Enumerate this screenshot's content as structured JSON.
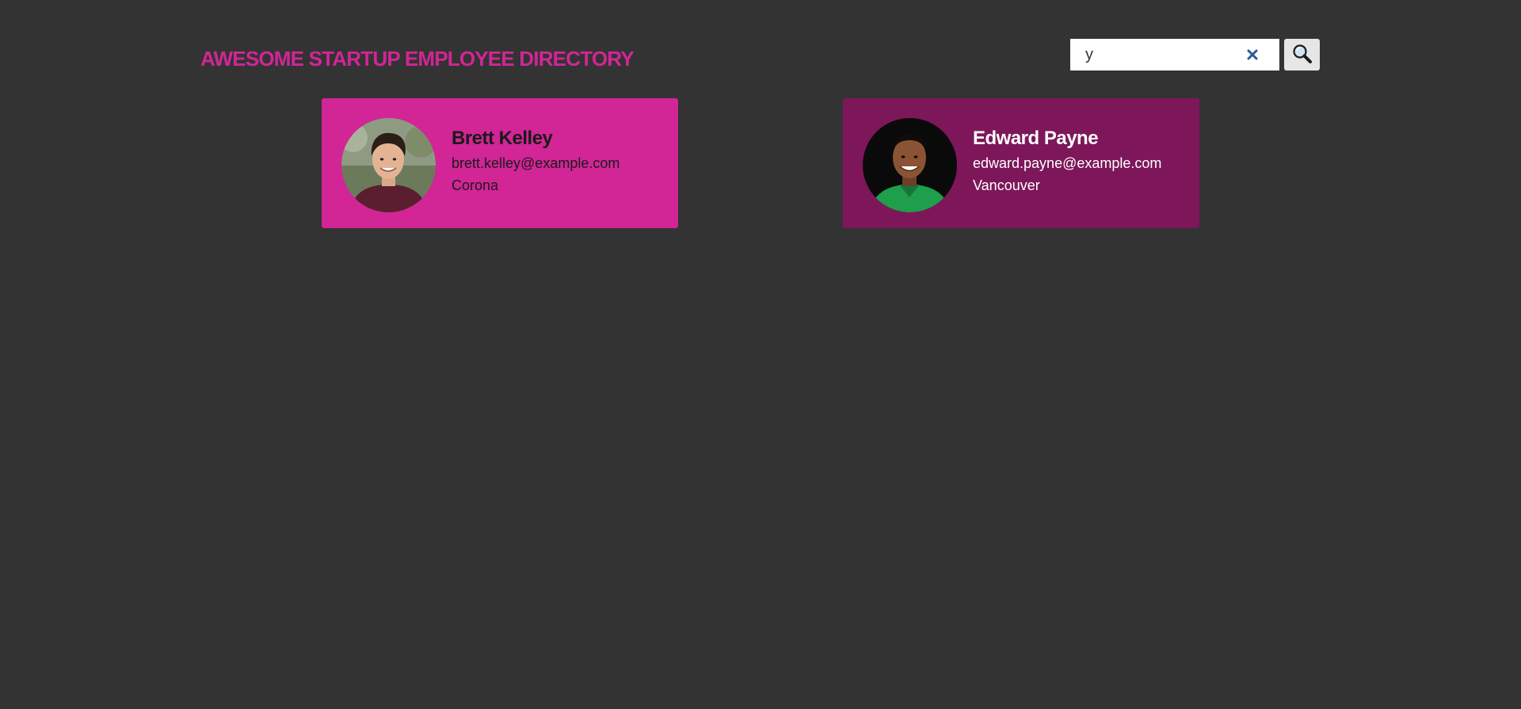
{
  "header": {
    "title": "AWESOME STARTUP EMPLOYEE DIRECTORY"
  },
  "search": {
    "value": "y",
    "clear_icon": "close-icon",
    "submit_icon": "magnifier-icon"
  },
  "employees": [
    {
      "name": "Brett Kelley",
      "email": "brett.kelley@example.com",
      "city": "Corona"
    },
    {
      "name": "Edward Payne",
      "email": "edward.payne@example.com",
      "city": "Vancouver"
    }
  ],
  "colors": {
    "background": "#333333",
    "accent": "#d22596",
    "card_primary": "#d22596",
    "card_secondary": "#7d175a",
    "clear_icon": "#2c5a97"
  }
}
